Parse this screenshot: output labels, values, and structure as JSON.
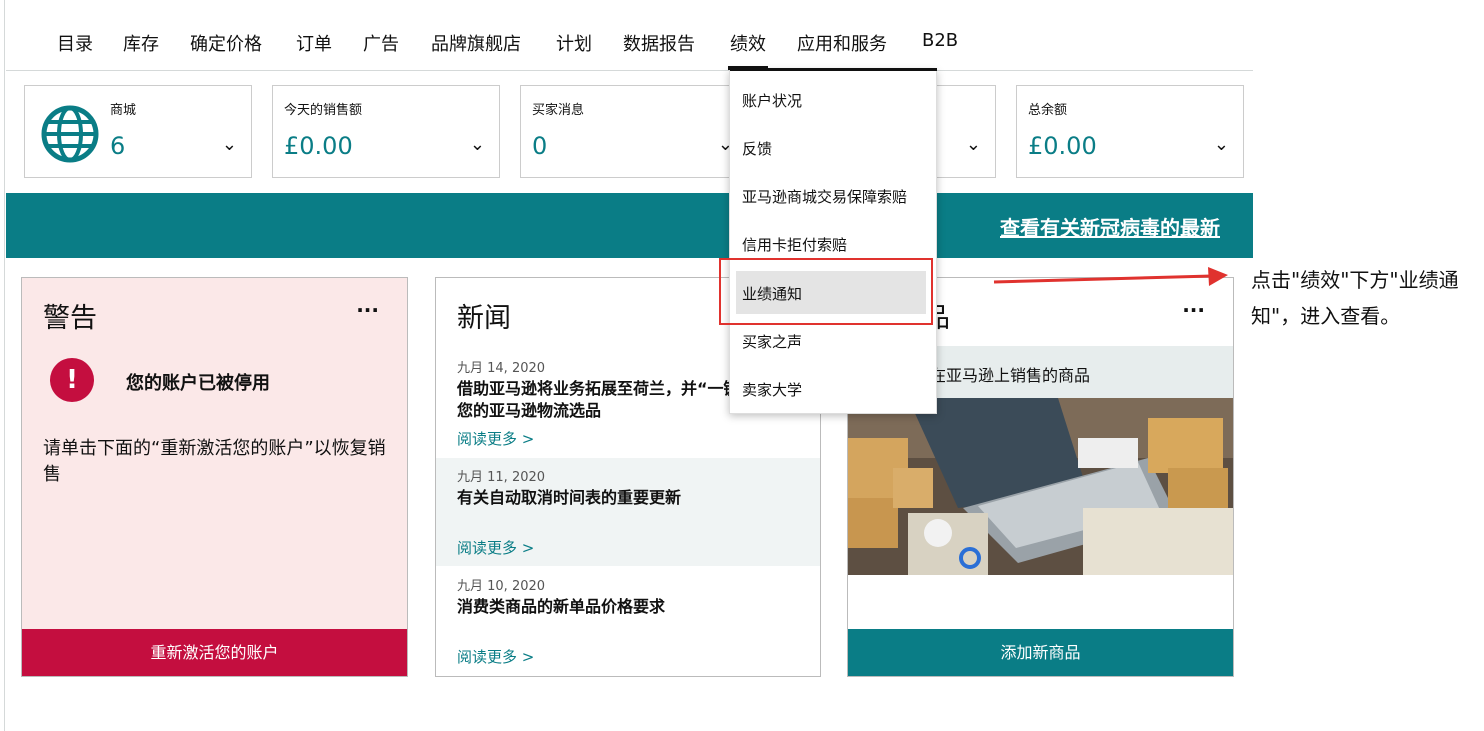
{
  "nav": [
    "目录",
    "库存",
    "确定价格",
    "订单",
    "广告",
    "品牌旗舰店",
    "计划",
    "数据报告",
    "绩效",
    "应用和服务",
    "B2B"
  ],
  "nav_active": "绩效",
  "cards": [
    {
      "label": "商城",
      "value": "6",
      "icon": "globe-icon"
    },
    {
      "label": "今天的销售额",
      "value": "£0.00"
    },
    {
      "label": "买家消息",
      "value": "0"
    },
    {
      "label": "",
      "value": ""
    },
    {
      "label": "总余额",
      "value": "£0.00"
    }
  ],
  "banner": {
    "link": "查看有关新冠病毒的最新"
  },
  "alert": {
    "title": "警告",
    "headline": "您的账户已被停用",
    "body": "请单击下面的“重新激活您的账户”以恢复销售",
    "button": "重新激活您的账户"
  },
  "news": {
    "title": "新闻",
    "items": [
      {
        "date": "九月 14, 2020",
        "title": "借助亚马逊将业务拓展至荷兰，并“一键”增加您的亚马逊物流选品",
        "more": "阅读更多 >"
      },
      {
        "date": "九月 11, 2020",
        "title": "有关自动取消时间表的重要更新",
        "more": "阅读更多 >"
      },
      {
        "date": "九月 10, 2020",
        "title": "消费类商品的新单品价格要求",
        "more": "阅读更多 >"
      }
    ]
  },
  "product": {
    "title": "新商品",
    "strip": "在亚马逊上销售的商品",
    "button": "添加新商品"
  },
  "dropdown": [
    "账户状况",
    "反馈",
    "亚马逊商城交易保障索赔",
    "信用卡拒付索赔",
    "业绩通知",
    "买家之声",
    "卖家大学"
  ],
  "dropdown_highlight": "业绩通知",
  "annotation": {
    "text": "点击\"绩效\"下方\"业绩通知\"，进入查看。",
    "color": "#e0322e"
  },
  "colors": {
    "teal": "#0a7d86",
    "alert_red": "#c40e3f",
    "alert_bg": "#fbe8e8"
  }
}
